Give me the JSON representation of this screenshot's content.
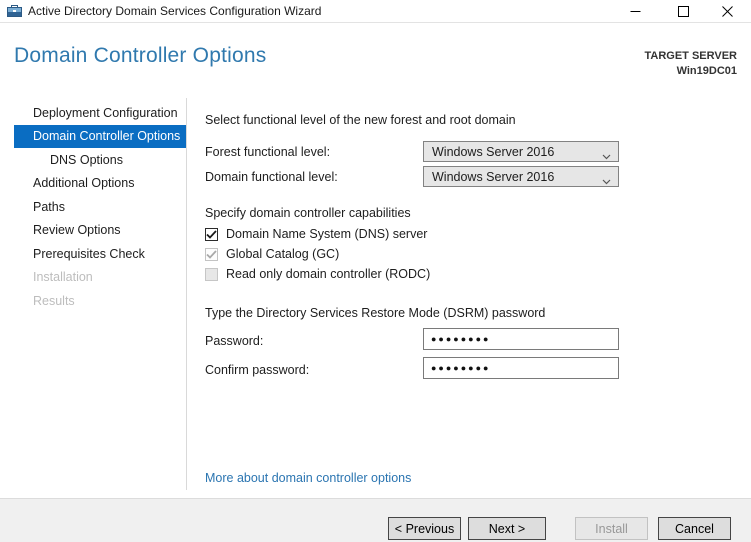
{
  "window": {
    "title": "Active Directory Domain Services Configuration Wizard"
  },
  "header": {
    "title": "Domain Controller Options",
    "target_server_label": "TARGET SERVER",
    "target_server_name": "Win19DC01"
  },
  "sidebar": {
    "items": [
      {
        "label": "Deployment Configuration",
        "state": "normal"
      },
      {
        "label": "Domain Controller Options",
        "state": "selected"
      },
      {
        "label": "DNS Options",
        "state": "normal-indented"
      },
      {
        "label": "Additional Options",
        "state": "normal"
      },
      {
        "label": "Paths",
        "state": "normal"
      },
      {
        "label": "Review Options",
        "state": "normal"
      },
      {
        "label": "Prerequisites Check",
        "state": "normal"
      },
      {
        "label": "Installation",
        "state": "disabled"
      },
      {
        "label": "Results",
        "state": "disabled"
      }
    ]
  },
  "content": {
    "functional_section": {
      "heading": "Select functional level of the new forest and root domain",
      "forest_label": "Forest functional level:",
      "forest_value": "Windows Server 2016",
      "domain_label": "Domain functional level:",
      "domain_value": "Windows Server 2016"
    },
    "capabilities_section": {
      "heading": "Specify domain controller capabilities",
      "checkboxes": [
        {
          "label": "Domain Name System (DNS) server",
          "checked": true,
          "enabled": true
        },
        {
          "label": "Global Catalog (GC)",
          "checked": true,
          "enabled": false
        },
        {
          "label": "Read only domain controller (RODC)",
          "checked": false,
          "enabled": false
        }
      ]
    },
    "dsrm_section": {
      "heading": "Type the Directory Services Restore Mode (DSRM) password",
      "password_label": "Password:",
      "password_value": "●●●●●●●●",
      "confirm_label": "Confirm password:",
      "confirm_value": "●●●●●●●●"
    },
    "link": "More about domain controller options"
  },
  "footer": {
    "previous_label": "< Previous",
    "next_label": "Next >",
    "install_label": "Install",
    "cancel_label": "Cancel"
  },
  "colors": {
    "accent_blue": "#0a6dc2",
    "header_blue": "#3079ae",
    "link_blue": "#2b75b1",
    "footer_gray": "#f0f0f0"
  }
}
